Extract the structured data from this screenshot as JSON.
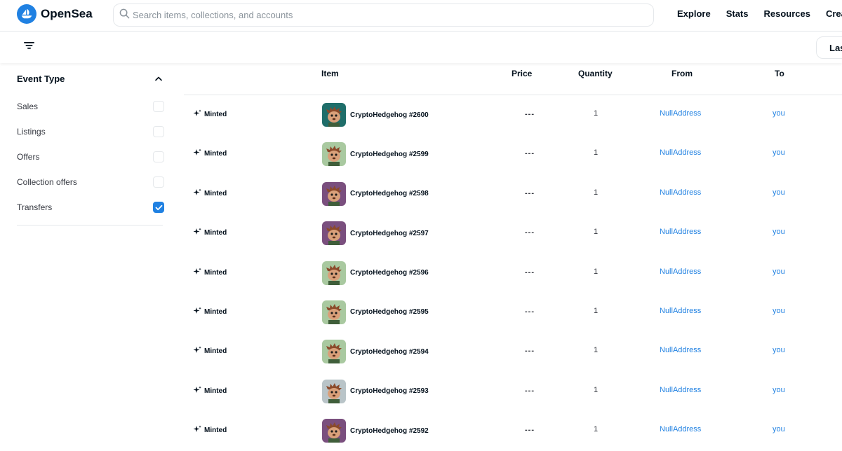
{
  "header": {
    "logo_text": "OpenSea",
    "search_placeholder": "Search items, collections, and accounts",
    "nav": [
      "Explore",
      "Stats",
      "Resources",
      "Create"
    ]
  },
  "subbar": {
    "sort_label": "Las"
  },
  "sidebar": {
    "section_title": "Event Type",
    "filters": [
      {
        "label": "Sales",
        "checked": false
      },
      {
        "label": "Listings",
        "checked": false
      },
      {
        "label": "Offers",
        "checked": false
      },
      {
        "label": "Collection offers",
        "checked": false
      },
      {
        "label": "Transfers",
        "checked": true
      }
    ]
  },
  "table": {
    "columns": {
      "item": "Item",
      "price": "Price",
      "quantity": "Quantity",
      "from": "From",
      "to": "To"
    },
    "rows": [
      {
        "event": "Minted",
        "item": "CryptoHedgehog #2600",
        "price": "---",
        "quantity": "1",
        "from": "NullAddress",
        "to": "you",
        "thumb_bg": "#1f6e6a"
      },
      {
        "event": "Minted",
        "item": "CryptoHedgehog #2599",
        "price": "---",
        "quantity": "1",
        "from": "NullAddress",
        "to": "you",
        "thumb_bg": "#a9c9a0"
      },
      {
        "event": "Minted",
        "item": "CryptoHedgehog #2598",
        "price": "---",
        "quantity": "1",
        "from": "NullAddress",
        "to": "you",
        "thumb_bg": "#7a4f7e"
      },
      {
        "event": "Minted",
        "item": "CryptoHedgehog #2597",
        "price": "---",
        "quantity": "1",
        "from": "NullAddress",
        "to": "you",
        "thumb_bg": "#7a4f7e"
      },
      {
        "event": "Minted",
        "item": "CryptoHedgehog #2596",
        "price": "---",
        "quantity": "1",
        "from": "NullAddress",
        "to": "you",
        "thumb_bg": "#a9c9a0"
      },
      {
        "event": "Minted",
        "item": "CryptoHedgehog #2595",
        "price": "---",
        "quantity": "1",
        "from": "NullAddress",
        "to": "you",
        "thumb_bg": "#a9c9a0"
      },
      {
        "event": "Minted",
        "item": "CryptoHedgehog #2594",
        "price": "---",
        "quantity": "1",
        "from": "NullAddress",
        "to": "you",
        "thumb_bg": "#a9c9a0"
      },
      {
        "event": "Minted",
        "item": "CryptoHedgehog #2593",
        "price": "---",
        "quantity": "1",
        "from": "NullAddress",
        "to": "you",
        "thumb_bg": "#b9c4c8"
      },
      {
        "event": "Minted",
        "item": "CryptoHedgehog #2592",
        "price": "---",
        "quantity": "1",
        "from": "NullAddress",
        "to": "you",
        "thumb_bg": "#7a4f7e"
      }
    ]
  },
  "colors": {
    "accent": "#2081e2",
    "border": "#e5e8eb",
    "text": "#04111d"
  },
  "icons": {
    "logo": "opensea-boat-icon",
    "search": "search-icon",
    "filter": "filter-lines-icon",
    "collapse": "chevron-up-icon",
    "event": "sparkle-icon",
    "check": "checkmark-icon"
  }
}
